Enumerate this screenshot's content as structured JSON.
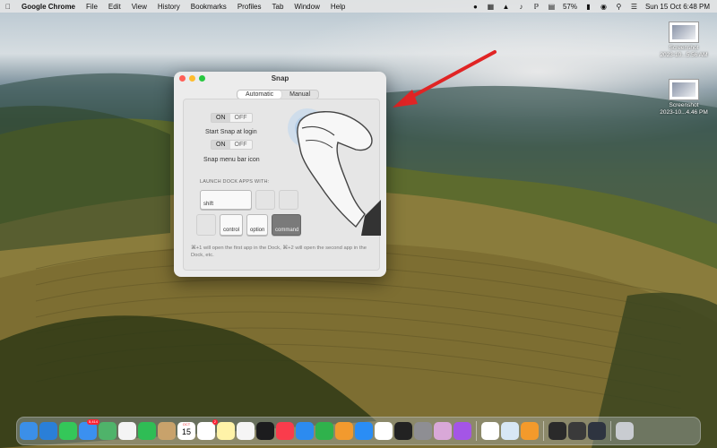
{
  "menubar": {
    "app": "Google Chrome",
    "items": [
      "File",
      "Edit",
      "View",
      "History",
      "Bookmarks",
      "Profiles",
      "Tab",
      "Window",
      "Help"
    ],
    "battery": "57%",
    "clock": "Sun 15 Oct 6:48 PM"
  },
  "desktop_icons": [
    {
      "label1": "Screenshot",
      "label2": "2023-10...5.56 AM"
    },
    {
      "label1": "Screenshot",
      "label2": "2023-10...4.46 PM"
    }
  ],
  "window": {
    "title": "Snap",
    "tabs": [
      "Automatic",
      "Manual"
    ],
    "active_tab": "Automatic",
    "toggle1": {
      "on": "ON",
      "off": "OFF",
      "label": "Start Snap at login"
    },
    "toggle2": {
      "on": "ON",
      "off": "OFF",
      "label": "Snap menu bar icon"
    },
    "section_label": "LAUNCH DOCK APPS WITH:",
    "keys": {
      "shift": "shift",
      "control": "control",
      "option": "option",
      "command": "command"
    },
    "note": "⌘+1 will open the first app in the Dock, ⌘+2 will open the second app in the Dock, etc."
  },
  "dock": {
    "apps": [
      {
        "icon": "finder-icon",
        "color": "#3b8fe8"
      },
      {
        "icon": "safari-icon",
        "color": "#2a7fd8"
      },
      {
        "icon": "messages-icon",
        "color": "#34c759"
      },
      {
        "icon": "mail-icon",
        "color": "#3b90f0"
      },
      {
        "icon": "maps-icon",
        "color": "#4fb36a"
      },
      {
        "icon": "photos-icon",
        "color": "#f4f4f4"
      },
      {
        "icon": "facetime-icon",
        "color": "#2fbd55"
      },
      {
        "icon": "notes-app-icon",
        "color": "#c8a26b"
      },
      {
        "icon": "calendar-icon",
        "color": "#ffffff"
      },
      {
        "icon": "reminders-icon",
        "color": "#ffffff"
      },
      {
        "icon": "notes-icon",
        "color": "#fff3a8"
      },
      {
        "icon": "freeform-icon",
        "color": "#f5f5f5"
      },
      {
        "icon": "apple-tv-icon",
        "color": "#1c1c1e"
      },
      {
        "icon": "music-icon",
        "color": "#fa3c4c"
      },
      {
        "icon": "keynote-icon",
        "color": "#2c8bf0"
      },
      {
        "icon": "numbers-icon",
        "color": "#2fb24c"
      },
      {
        "icon": "pages-icon",
        "color": "#f29a2e"
      },
      {
        "icon": "app-store-icon",
        "color": "#2a8df5"
      },
      {
        "icon": "slack-icon",
        "color": "#ffffff"
      },
      {
        "icon": "figma-icon",
        "color": "#222222"
      },
      {
        "icon": "system-settings-icon",
        "color": "#8e8e93"
      },
      {
        "icon": "grid-app-icon",
        "color": "#d9a8d8"
      },
      {
        "icon": "podcasts-icon",
        "color": "#a455e6"
      },
      {
        "icon": "chrome-icon",
        "color": "#ffffff"
      },
      {
        "icon": "preview-icon",
        "color": "#d7e7f5"
      },
      {
        "icon": "infuse-icon",
        "color": "#f39a2b"
      },
      {
        "icon": "window-thumb-icon",
        "color": "#2a2a2a"
      },
      {
        "icon": "window-thumb-icon",
        "color": "#3a3a3a"
      },
      {
        "icon": "window-thumb-icon",
        "color": "#2e3440"
      },
      {
        "icon": "trash-icon",
        "color": "#c9ccd1"
      }
    ],
    "badges": {
      "mail": "5,414",
      "reminders": "2",
      "calendar_month": "OCT",
      "calendar_day": "15"
    }
  }
}
